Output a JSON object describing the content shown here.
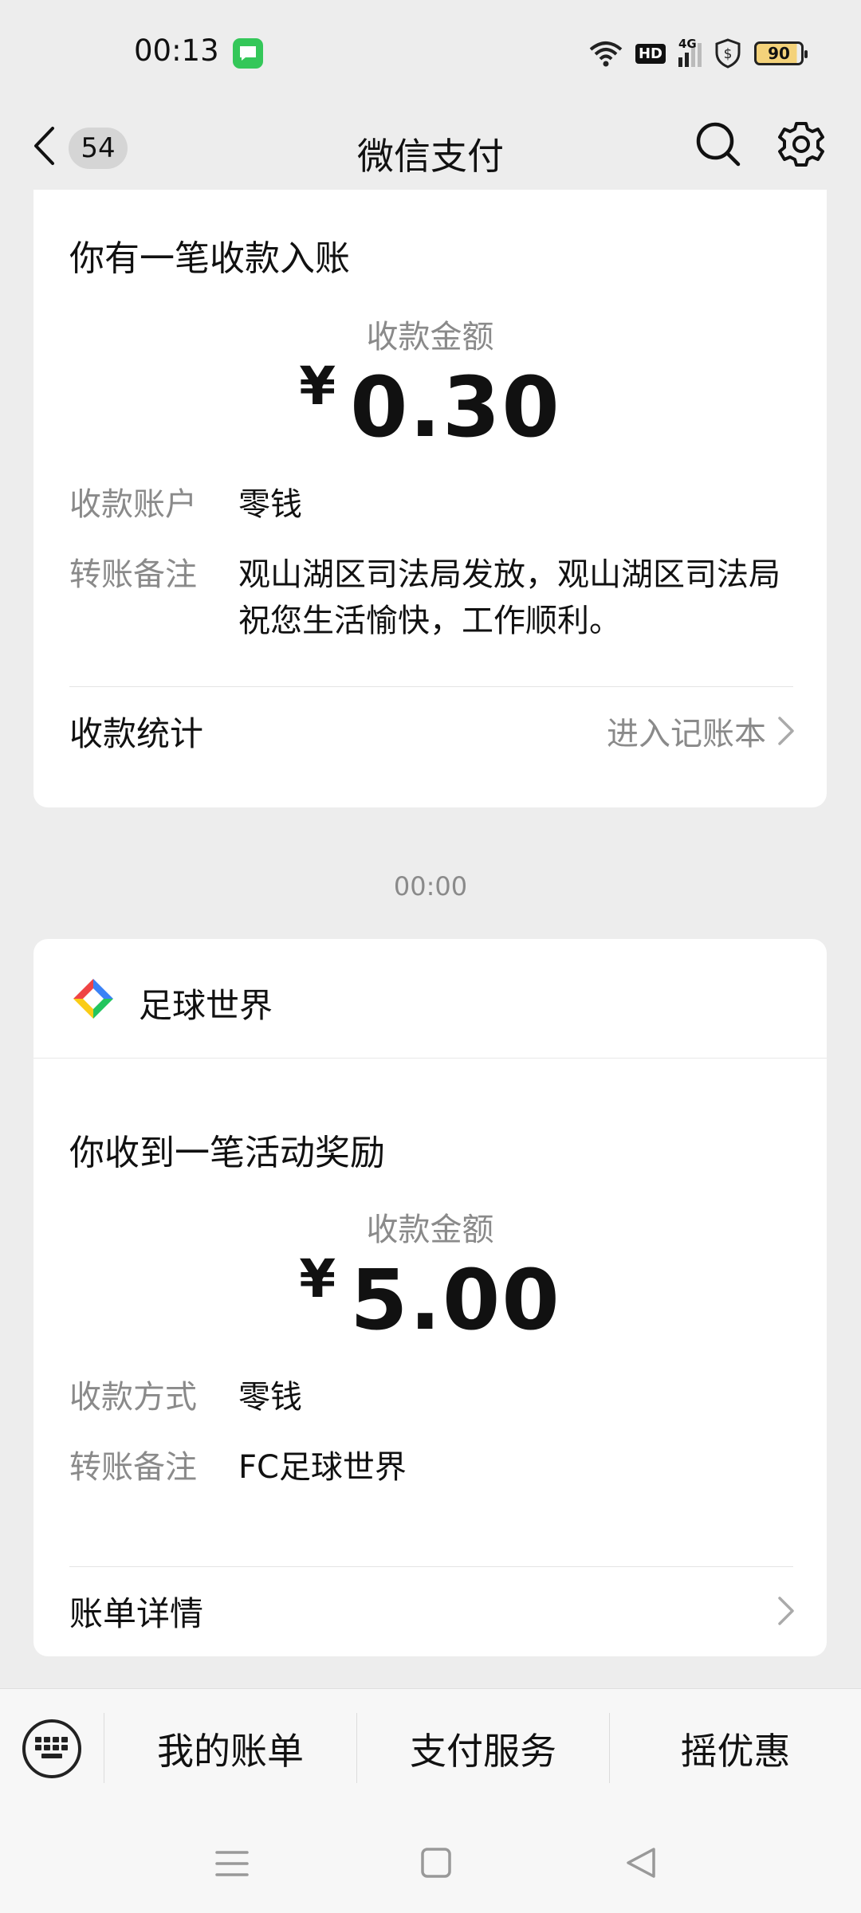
{
  "status_bar": {
    "time": "00:13",
    "network": "4G",
    "hd_label": "HD",
    "battery_level": "90"
  },
  "nav": {
    "unread_count": "54",
    "title": "微信支付"
  },
  "card1": {
    "headline": "你有一笔收款入账",
    "amount_label": "收款金额",
    "currency": "¥",
    "amount": "0.30",
    "rows": [
      {
        "key": "收款账户",
        "value": "零钱"
      },
      {
        "key": "转账备注",
        "value": "观山湖区司法局发放，观山湖区司法局祝您生活愉快，工作顺利。"
      }
    ],
    "footer_left": "收款统计",
    "footer_right": "进入记账本"
  },
  "time_separator": "00:00",
  "card2": {
    "merchant_name": "足球世界",
    "headline": "你收到一笔活动奖励",
    "amount_label": "收款金额",
    "currency": "¥",
    "amount": "5.00",
    "rows": [
      {
        "key": "收款方式",
        "value": "零钱"
      },
      {
        "key": "转账备注",
        "value": "FC足球世界"
      }
    ],
    "footer_left": "账单详情"
  },
  "bottom_menu": {
    "items": [
      "我的账单",
      "支付服务",
      "摇优惠"
    ]
  },
  "colors": {
    "background": "#ededed",
    "card": "#ffffff",
    "secondary_text": "#8a8a8a",
    "status_green": "#34c759"
  }
}
